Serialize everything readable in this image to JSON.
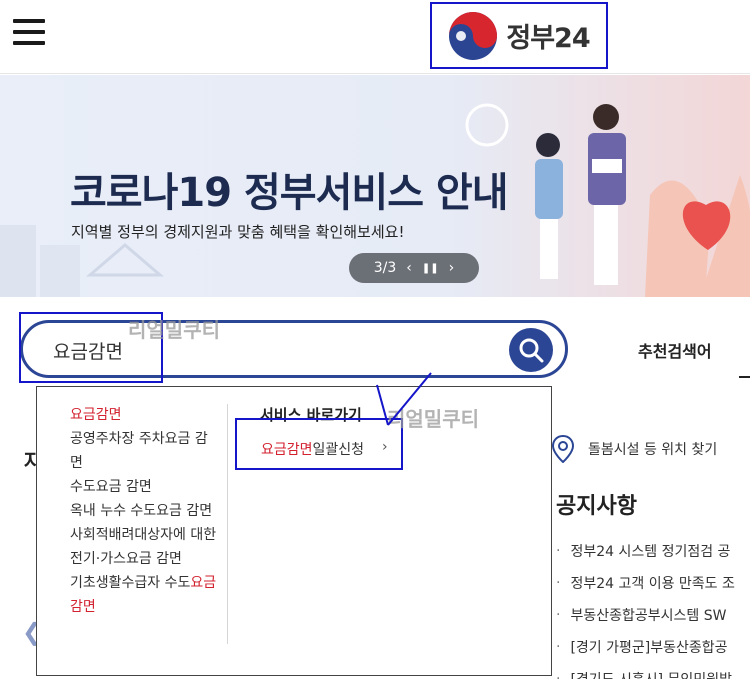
{
  "header": {
    "logo_text": "정부24"
  },
  "banner": {
    "title": "코로나19 정부서비스 안내",
    "subtitle": "지역별 정부의 경제지원과 맞춤 혜택을 확인해보세요!",
    "pager": "3/3",
    "prev_icon": "‹",
    "pause_icon": "⏸",
    "next_icon": "›"
  },
  "search": {
    "value": "요금감면",
    "watermark": "리얼밀쿠티"
  },
  "recommended": {
    "label": "추천검색어"
  },
  "background": {
    "left_heading_fragment": "자",
    "location_text": "돌봄시설 등 위치 찾기",
    "notice_title": "공지사항",
    "notices": [
      "정부24 시스템 정기점검 공",
      "정부24 고객 이용 만족도 조",
      "부동산종합공부시스템 SW",
      "[경기 가평군]부동산종합공",
      "[경기도 시흥시] 무인민원발"
    ]
  },
  "dropdown": {
    "suggestions": [
      {
        "pre": "",
        "hl": "요금감면",
        "post": ""
      },
      {
        "pre": "공영주차장 주차요금 감면",
        "hl": "",
        "post": ""
      },
      {
        "pre": "수도요금 감면",
        "hl": "",
        "post": ""
      },
      {
        "pre": "옥내 누수 수도요금 감면",
        "hl": "",
        "post": ""
      },
      {
        "pre": "사회적배려대상자에 대한 전기·가스요금 감면",
        "hl": "",
        "post": ""
      },
      {
        "pre": "기초생활수급자 수도",
        "hl": "요금감면",
        "post": ""
      }
    ],
    "shortcut_title": "서비스 바로가기",
    "shortcut": {
      "hl": "요금감면",
      "post": "일괄신청",
      "chevron": "›"
    },
    "watermark": "리얼밀쿠티"
  },
  "colors": {
    "accent": "#2c4696",
    "highlight": "#d3212f",
    "annotation": "#1515c9"
  }
}
